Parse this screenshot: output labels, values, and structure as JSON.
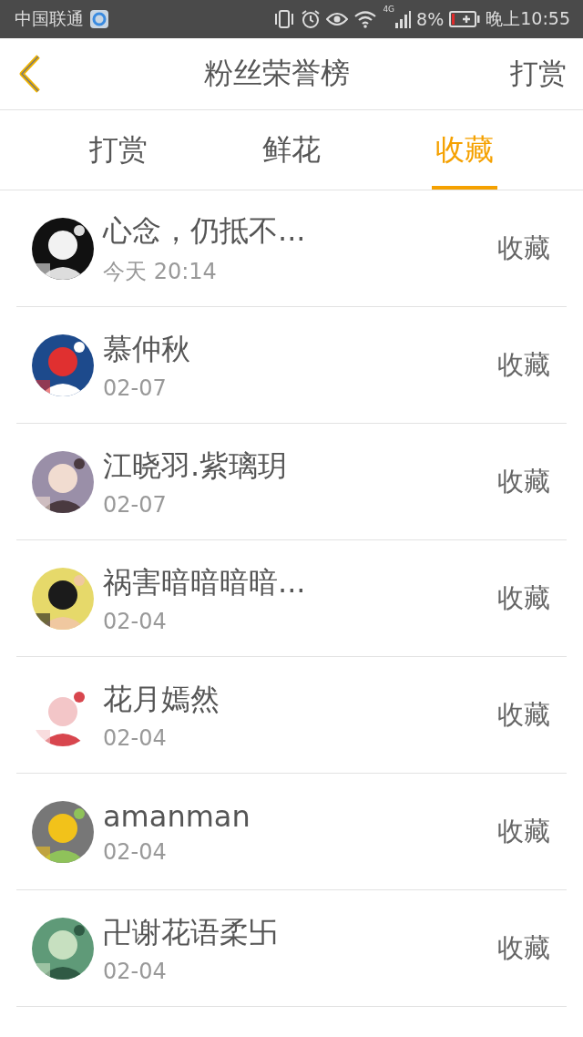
{
  "status_bar": {
    "carrier": "中国联通",
    "network": "4G",
    "battery": "8%",
    "time": "晚上10:55"
  },
  "header": {
    "title": "粉丝荣誉榜",
    "action": "打赏"
  },
  "tabs": [
    {
      "label": "打赏",
      "selected": false
    },
    {
      "label": "鲜花",
      "selected": false
    },
    {
      "label": "收藏",
      "selected": true
    }
  ],
  "fans": [
    {
      "name": "心念，仍抵不...",
      "time": "今天 20:14",
      "action": "收藏"
    },
    {
      "name": "慕仲秋",
      "time": "02-07",
      "action": "收藏"
    },
    {
      "name": "江晓羽.紫璃玥",
      "time": "02-07",
      "action": "收藏"
    },
    {
      "name": "祸害暗暗暗暗...",
      "time": "02-04",
      "action": "收藏"
    },
    {
      "name": "花月嫣然",
      "time": "02-04",
      "action": "收藏"
    },
    {
      "name": "amanman",
      "time": "02-04",
      "action": "收藏"
    },
    {
      "name": "卍谢花语柔卐",
      "time": "02-04",
      "action": "收藏"
    }
  ]
}
